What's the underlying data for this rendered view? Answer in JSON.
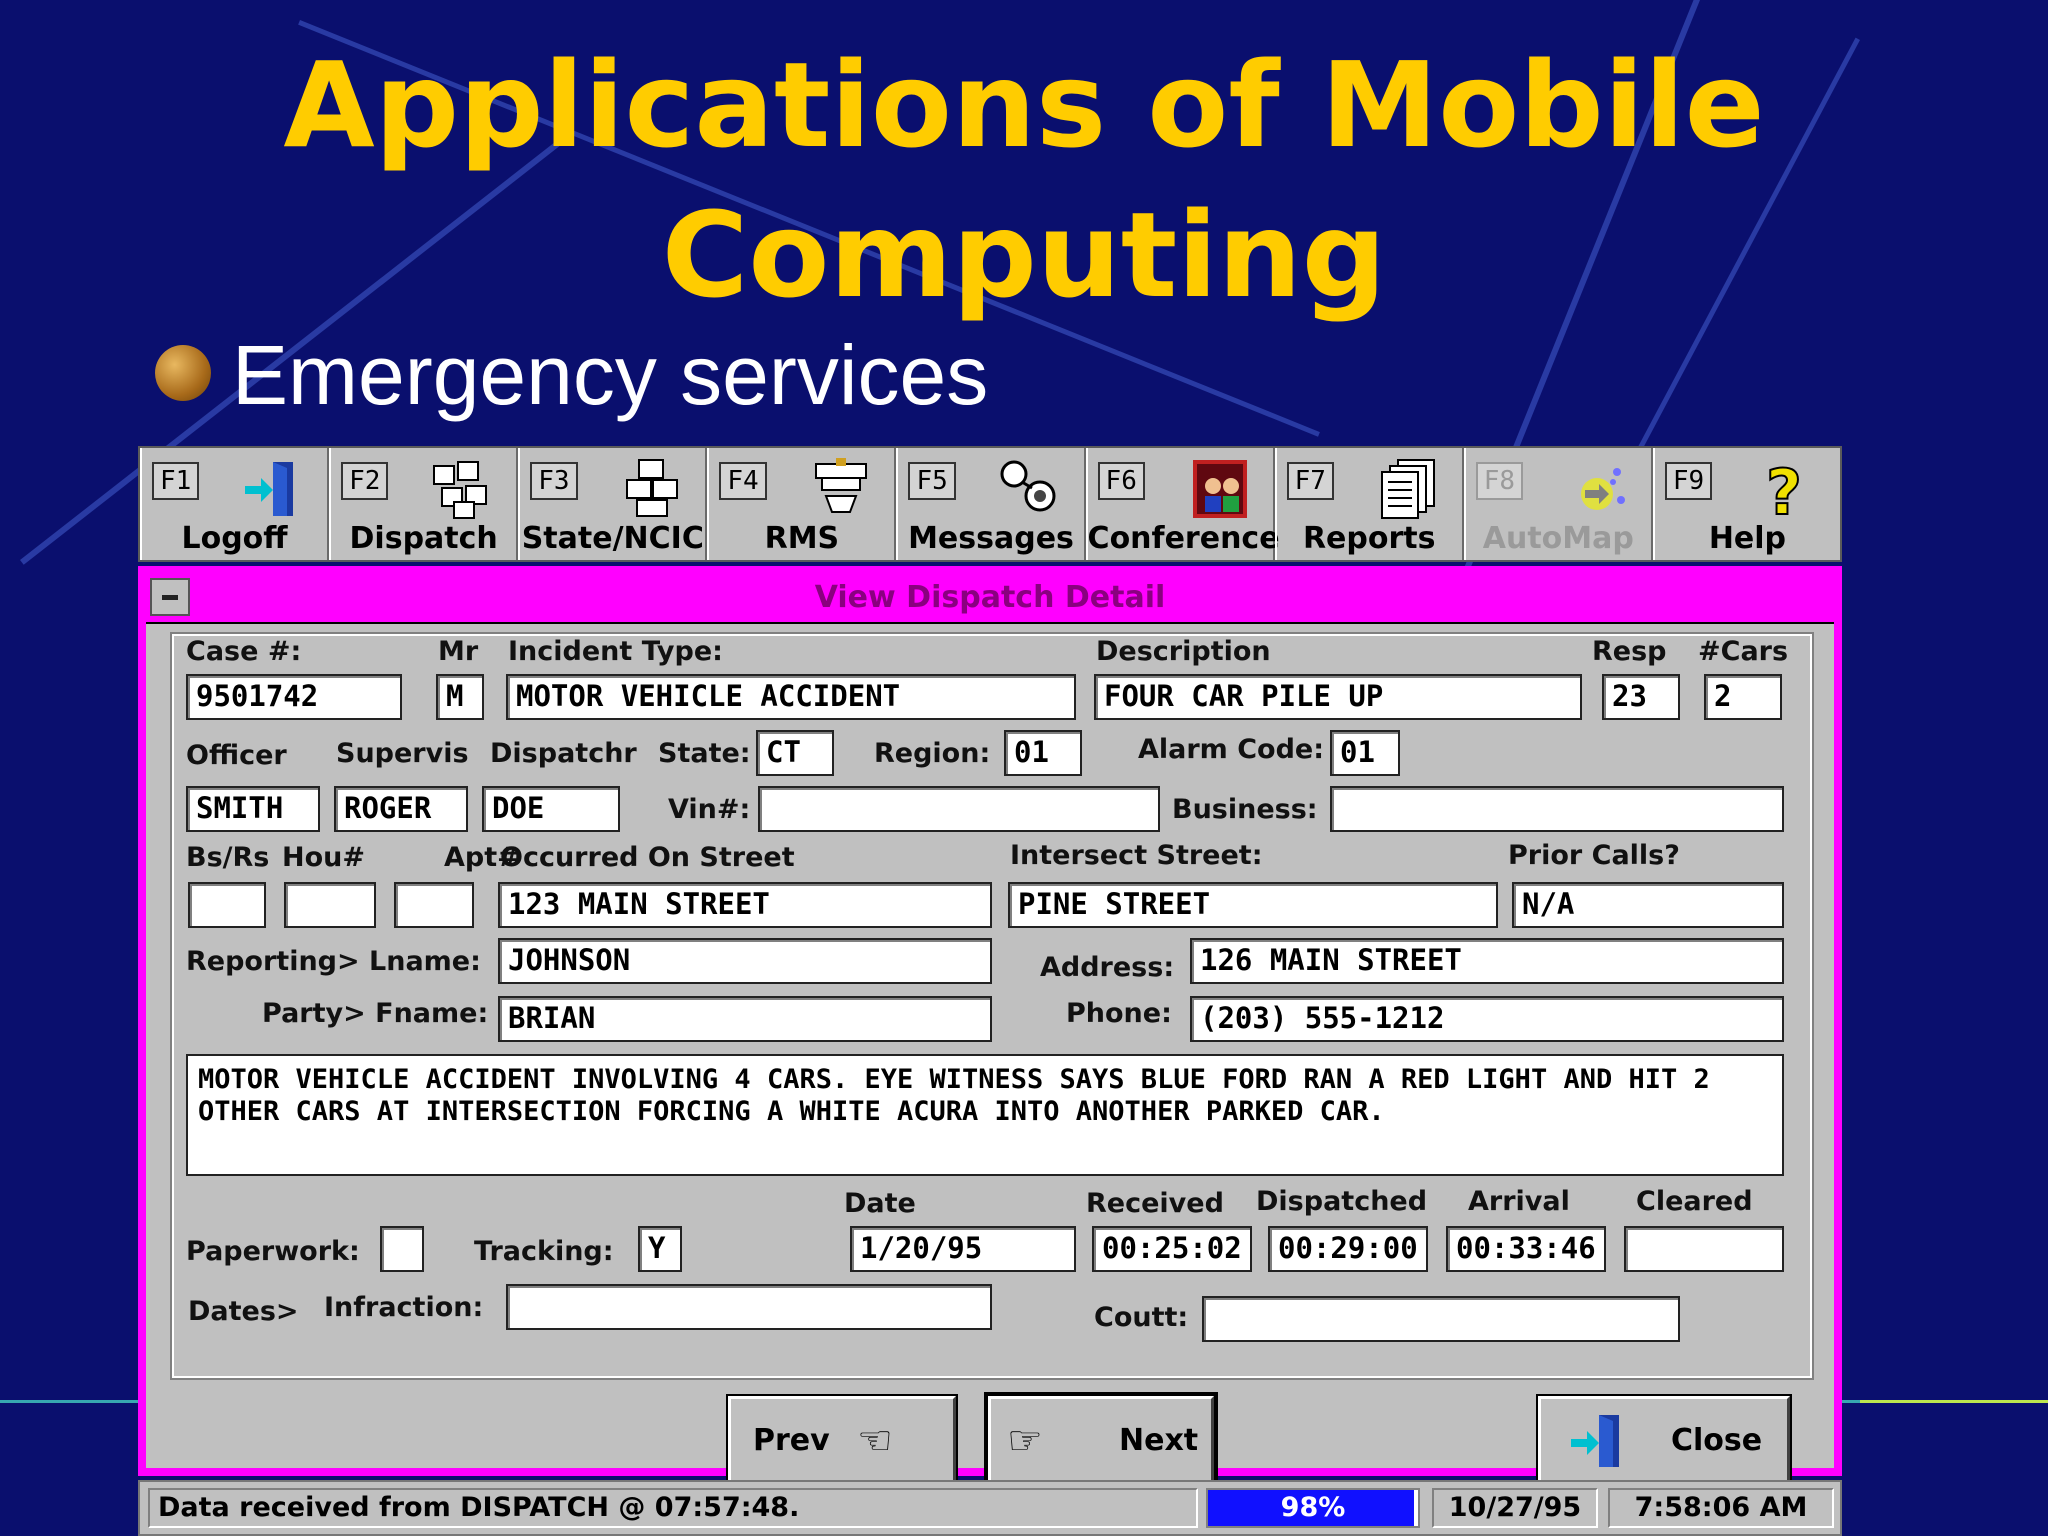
{
  "slide": {
    "title_line1": "Applications of Mobile",
    "title_line2": "Computing",
    "bullet": "Emergency  services"
  },
  "toolbar": [
    {
      "key": "F1",
      "label": "Logoff",
      "icon": "logoff-door-icon"
    },
    {
      "key": "F2",
      "label": "Dispatch",
      "icon": "dispatch-boxes-icon"
    },
    {
      "key": "F3",
      "label": "State/NCIC",
      "icon": "computer-stack-icon"
    },
    {
      "key": "F4",
      "label": "RMS",
      "icon": "records-icon"
    },
    {
      "key": "F5",
      "label": "Messages",
      "icon": "messages-icon"
    },
    {
      "key": "F6",
      "label": "Conference",
      "icon": "conference-icon"
    },
    {
      "key": "F7",
      "label": "Reports",
      "icon": "reports-icon"
    },
    {
      "key": "F8",
      "label": "AutoMap",
      "icon": "automap-icon",
      "disabled": true
    },
    {
      "key": "F9",
      "label": "Help",
      "icon": "help-question-icon"
    }
  ],
  "window": {
    "title": "View Dispatch Detail"
  },
  "form": {
    "labels": {
      "case": "Case #:",
      "mr": "Mr",
      "incident_type": "Incident Type:",
      "description": "Description",
      "resp": "Resp",
      "cars": "#Cars",
      "officer": "Officer",
      "supervis": "Supervis",
      "dispatchr": "Dispatchr",
      "state": "State:",
      "region": "Region:",
      "alarm": "Alarm Code:",
      "vin": "Vin#:",
      "business": "Business:",
      "bsrs": "Bs/Rs",
      "hou": "Hou#",
      "apt": "Apt#",
      "occurred": "Occurred On Street",
      "intersect": "Intersect Street:",
      "prior": "Prior Calls?",
      "reporting": "Reporting> Lname:",
      "address": "Address:",
      "party": "Party> Fname:",
      "phone": "Phone:",
      "paperwork": "Paperwork:",
      "tracking": "Tracking:",
      "date": "Date",
      "received": "Received",
      "dispatched": "Dispatched",
      "arrival": "Arrival",
      "cleared": "Cleared",
      "dates": "Dates>",
      "infraction": "Infraction:",
      "court": "Coutt:"
    },
    "values": {
      "case": "9501742",
      "mr": "M",
      "incident_type": "MOTOR VEHICLE ACCIDENT",
      "description": "FOUR CAR PILE UP",
      "resp": "23",
      "cars": "2",
      "officer": "SMITH",
      "supervis": "ROGER",
      "dispatchr": "DOE",
      "state": "CT",
      "region": "01",
      "alarm": "01",
      "vin": "",
      "business": "",
      "bsrs": "",
      "hou": "",
      "apt": "",
      "occurred": "123 MAIN STREET",
      "intersect": "PINE STREET",
      "prior": "N/A",
      "lname": "JOHNSON",
      "address": "126 MAIN STREET",
      "fname": "BRIAN",
      "phone": "(203) 555-1212",
      "narrative": "MOTOR VEHICLE ACCIDENT INVOLVING 4 CARS. EYE WITNESS SAYS BLUE FORD RAN A RED LIGHT AND HIT 2 OTHER CARS AT INTERSECTION FORCING A WHITE ACURA INTO ANOTHER PARKED CAR.",
      "paperwork": "",
      "tracking": "Y",
      "date": "1/20/95",
      "received": "00:25:02",
      "dispatched": "00:29:00",
      "arrival": "00:33:46",
      "cleared": "",
      "infraction": "",
      "court": ""
    }
  },
  "buttons": {
    "prev": "Prev",
    "next": "Next",
    "close": "Close"
  },
  "status": {
    "message": "Data received from DISPATCH @ 07:57:48.",
    "progress_percent": 98,
    "progress_label": "98%",
    "date": "10/27/95",
    "time": "7:58:06 AM"
  },
  "colors": {
    "background": "#0a0f6e",
    "title": "#ffcc00",
    "window_frame": "#ff00ff",
    "progress": "#1010ff"
  }
}
